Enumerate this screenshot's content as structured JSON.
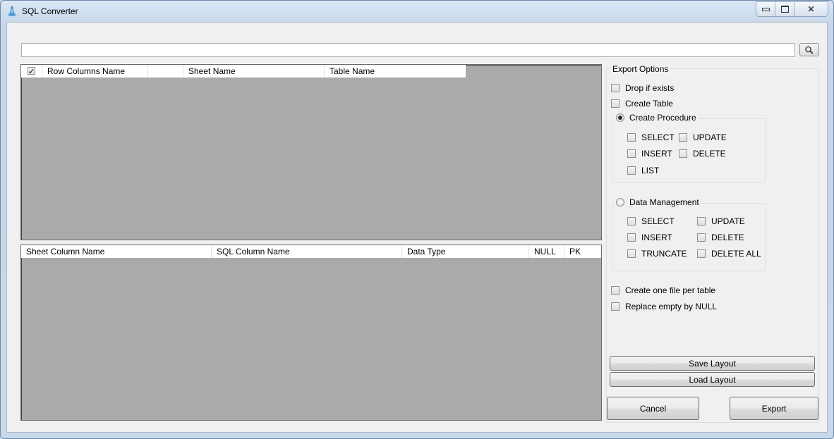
{
  "window": {
    "title": "SQL Converter"
  },
  "caption": {
    "minimize": "▭",
    "restore": "⧉",
    "close": "✕"
  },
  "path_input": {
    "value": ""
  },
  "upper_grid": {
    "select_all_checked": true,
    "columns": [
      "Row Columns Name",
      "",
      "Sheet Name",
      "Table Name"
    ]
  },
  "lower_grid": {
    "columns": [
      "Sheet Column Name",
      "SQL Column Name",
      "Data Type",
      "NULL",
      "PK"
    ]
  },
  "export_options": {
    "label": "Export Options",
    "drop_if_exists": "Drop if exists",
    "create_table": "Create Table",
    "create_procedure": {
      "label": "Create Procedure",
      "selected": true,
      "select": "SELECT",
      "update": "UPDATE",
      "insert": "INSERT",
      "delete": "DELETE",
      "list": "LIST"
    },
    "data_management": {
      "label": "Data Management",
      "selected": false,
      "select": "SELECT",
      "update": "UPDATE",
      "insert": "INSERT",
      "delete": "DELETE",
      "truncate": "TRUNCATE",
      "delete_all": "DELETE ALL"
    },
    "one_file_per_table": "Create one file per table",
    "replace_empty_null": "Replace empty by NULL"
  },
  "buttons": {
    "save_layout": "Save Layout",
    "load_layout": "Load Layout",
    "cancel": "Cancel",
    "export": "Export"
  }
}
